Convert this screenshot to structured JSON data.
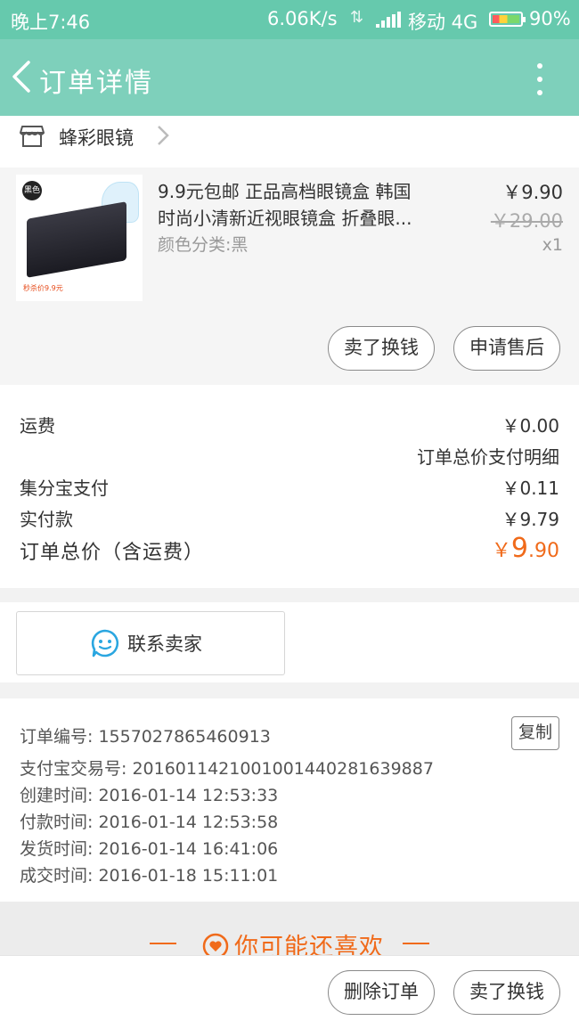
{
  "status_bar": {
    "time": "晚上7:46",
    "speed": "6.06K/s",
    "carrier": "移动 4G",
    "battery": "90%"
  },
  "header": {
    "title": "订单详情"
  },
  "shop": {
    "name": "蜂彩眼镜"
  },
  "product": {
    "thumb_tag": "黑色",
    "thumb_promo": "秒杀价9.9元",
    "name_line1": "9.9元包邮 正品高档眼镜盒 韩国",
    "name_line2": "时尚小清新近视眼镜盒 折叠眼...",
    "variant": "颜色分类:黑",
    "price": "￥9.90",
    "original_price": "￥29.00",
    "quantity": "x1",
    "actions": {
      "resell": "卖了换钱",
      "after_sale": "申请售后"
    }
  },
  "summary": {
    "shipping_label": "运费",
    "shipping_value": "￥0.00",
    "detail_link": "订单总价支付明细",
    "points_label": "集分宝支付",
    "points_value": "￥0.11",
    "paid_label": "实付款",
    "paid_value": "￥9.79",
    "total_label": "订单总价（含运费）",
    "total_symbol": "￥",
    "total_int": "9",
    "total_dec": ".90"
  },
  "contact": {
    "label": "联系卖家"
  },
  "order_info": {
    "order_no_label": "订单编号:",
    "order_no": "1557027865460913",
    "copy_label": "复制",
    "alipay_label": "支付宝交易号:",
    "alipay_no": "2016011421001001440281639887",
    "created_label": "创建时间:",
    "created": "2016-01-14 12:53:33",
    "paid_label": "付款时间:",
    "paid": "2016-01-14 12:53:58",
    "shipped_label": "发货时间:",
    "shipped": "2016-01-14 16:41:06",
    "closed_label": "成交时间:",
    "closed": "2016-01-18 15:11:01"
  },
  "recommend": {
    "title": "你可能还喜欢"
  },
  "bottom_bar": {
    "delete_label": "删除订单",
    "resell_label": "卖了换钱"
  },
  "colors": {
    "accent": "#f06a1a",
    "header": "#7ed0bb",
    "status": "#66c9ad"
  }
}
